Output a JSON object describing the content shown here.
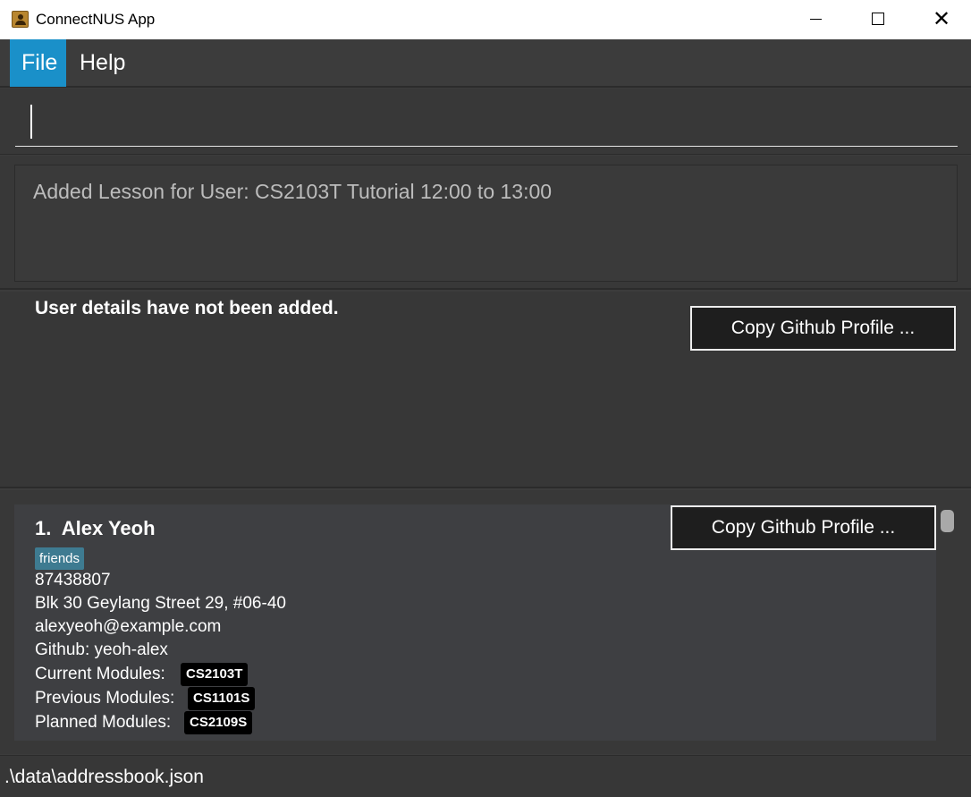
{
  "window": {
    "title": "ConnectNUS App",
    "minimize_icon": "minimize-icon",
    "maximize_icon": "maximize-icon",
    "close_icon": "close-icon",
    "close_glyph": "✕"
  },
  "menu": {
    "items": [
      {
        "label": "File",
        "active": true
      },
      {
        "label": "Help",
        "active": false
      }
    ],
    "active_color": "#1a90c9"
  },
  "command": {
    "value": "",
    "placeholder": ""
  },
  "result": {
    "message": "Added Lesson for User: CS2103T Tutorial 12:00 to 13:00"
  },
  "user_panel": {
    "message": "User details have not been added.",
    "copy_button": "Copy Github Profile ..."
  },
  "persons": [
    {
      "index": "1.",
      "name": "Alex Yeoh",
      "tags": [
        "friends"
      ],
      "phone": "87438807",
      "address": "Blk 30 Geylang Street 29, #06-40",
      "email": "alexyeoh@example.com",
      "github": "Github: yeoh-alex",
      "current_modules_label": "Current Modules:",
      "current_modules": [
        "CS2103T"
      ],
      "previous_modules_label": "Previous Modules:",
      "previous_modules": [
        "CS1101S"
      ],
      "planned_modules_label": "Planned Modules:",
      "planned_modules": [
        "CS2109S"
      ],
      "copy_button": "Copy Github Profile ..."
    }
  ],
  "status": {
    "path": ".\\data\\addressbook.json"
  },
  "colors": {
    "background": "#3c3c3c",
    "tag": "#3e7b91",
    "module_badge": "#000000"
  }
}
